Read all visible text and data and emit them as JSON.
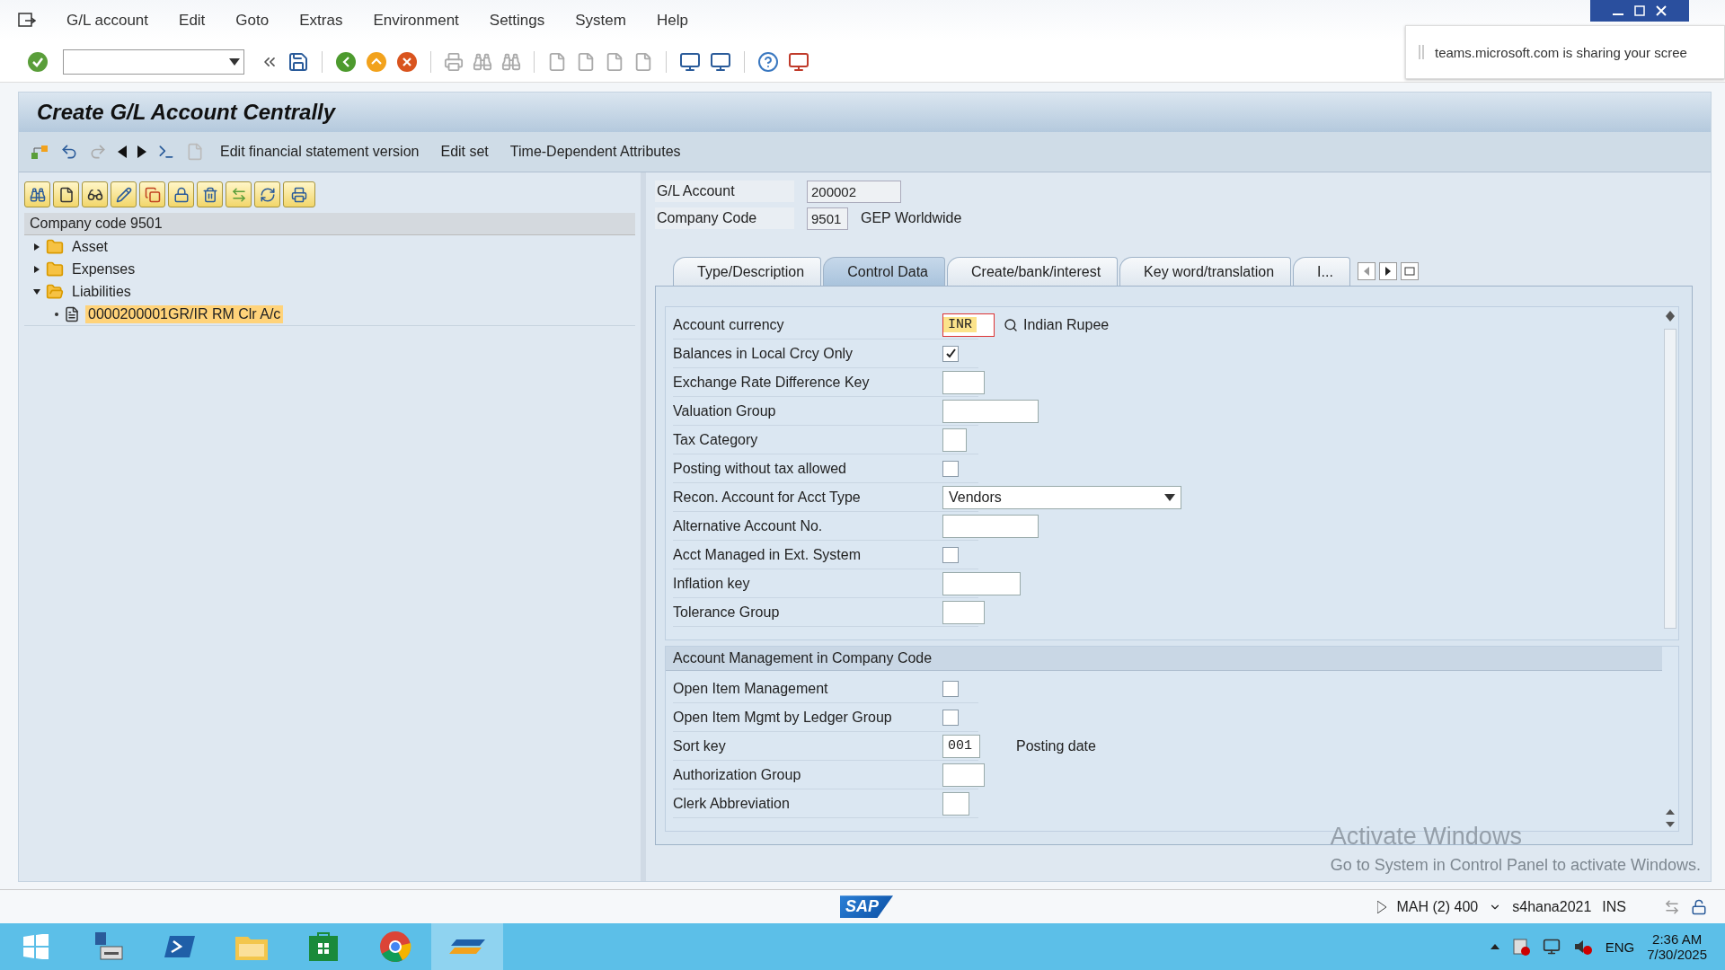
{
  "menu_bar": [
    "G/L account",
    "Edit",
    "Goto",
    "Extras",
    "Environment",
    "Settings",
    "System",
    "Help"
  ],
  "notification": {
    "text": "teams.microsoft.com is sharing your scree"
  },
  "title": "Create G/L Account Centrally",
  "app_toolbar": [
    "Edit financial statement version",
    "Edit set",
    "Time-Dependent Attributes"
  ],
  "tree": {
    "header": "Company code 9501",
    "items": [
      {
        "label": "Asset",
        "expanded": false,
        "selected": false
      },
      {
        "label": "Expenses",
        "expanded": false,
        "selected": false
      },
      {
        "label": "Liabilities",
        "expanded": true,
        "selected": false,
        "children": [
          {
            "label": "0000200001GR/IR RM Clr A/c",
            "selected": true
          }
        ]
      }
    ]
  },
  "header_fields": [
    {
      "label": "G/L Account",
      "value": "200002"
    },
    {
      "label": "Company Code",
      "value": "9501",
      "description": "GEP Worldwide"
    }
  ],
  "tabs": [
    {
      "label": "Type/Description",
      "selected": false
    },
    {
      "label": "Control Data",
      "selected": true
    },
    {
      "label": "Create/bank/interest",
      "selected": false
    },
    {
      "label": "Key word/translation",
      "selected": false
    },
    {
      "label": "I...",
      "selected": false
    }
  ],
  "fields": [
    {
      "kind": "input",
      "label": "Account currency",
      "value": "INR",
      "focused": true,
      "value_help": true,
      "description": "Indian Rupee"
    },
    {
      "kind": "checkbox",
      "label": "Balances in Local Crcy Only",
      "checked": true
    },
    {
      "kind": "input",
      "label": "Exchange Rate Difference Key"
    },
    {
      "kind": "input",
      "label": "Valuation Group"
    },
    {
      "kind": "input",
      "label": "Tax Category"
    },
    {
      "kind": "checkbox",
      "label": "Posting without tax allowed",
      "checked": false
    },
    {
      "kind": "dropdown",
      "label": "Recon. Account for Acct Type",
      "value": "Vendors"
    },
    {
      "kind": "input",
      "label": "Alternative Account No."
    },
    {
      "kind": "checkbox",
      "label": "Acct Managed in Ext. System",
      "checked": false
    },
    {
      "kind": "input",
      "label": "Inflation key"
    },
    {
      "kind": "input",
      "label": "Tolerance Group"
    }
  ],
  "section": {
    "title": "Account Management in Company Code",
    "fields": [
      {
        "kind": "checkbox",
        "label": "Open Item Management",
        "checked": false
      },
      {
        "kind": "checkbox",
        "label": "Open Item Mgmt by Ledger Group",
        "checked": false
      },
      {
        "kind": "input",
        "label": "Sort key",
        "value": "001",
        "description": "Posting date"
      },
      {
        "kind": "input",
        "label": "Authorization Group"
      },
      {
        "kind": "input",
        "label": "Clerk Abbreviation"
      }
    ]
  },
  "activation": {
    "title": "Activate Windows",
    "text": "Go to System in Control Panel to activate Windows."
  },
  "status_bar": {
    "logo": "SAP",
    "system": "MAH (2) 400",
    "server": "s4hana2021",
    "mode": "INS"
  },
  "taskbar": {
    "language": "ENG",
    "time": "2:36 AM",
    "date": "7/30/2025"
  }
}
